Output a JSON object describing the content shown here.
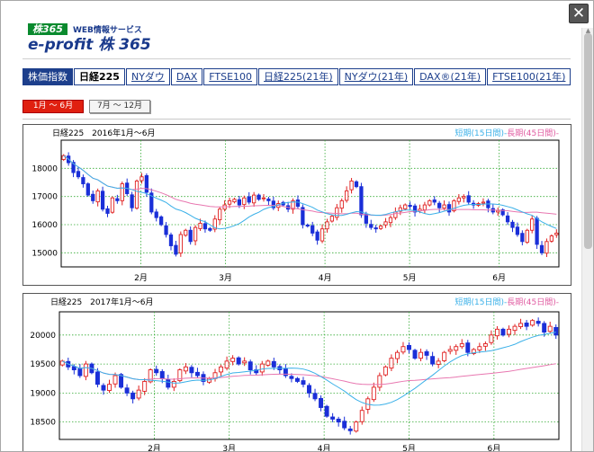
{
  "header": {
    "logo_badge": "株365",
    "logo_sub": "WEB情報サービス",
    "logo_main": "e-profit 株 365"
  },
  "icons": {
    "close": "close-icon"
  },
  "tabs": [
    {
      "label": "株価指数"
    },
    {
      "label": "日経225"
    },
    {
      "label": "NYダウ"
    },
    {
      "label": "DAX"
    },
    {
      "label": "FTSE100"
    },
    {
      "label": "日経225(21年)"
    },
    {
      "label": "NYダウ(21年)"
    },
    {
      "label": "DAX®(21年)"
    },
    {
      "label": "FTSE100(21年)"
    }
  ],
  "periods": [
    {
      "label": "1月 ～ 6月"
    },
    {
      "label": "7月 ～ 12月"
    }
  ],
  "colors": {
    "up": "#e02020",
    "down": "#1a2fd8",
    "short_ma": "#3ab0e8",
    "long_ma": "#e877b0",
    "grid": "#33aa33"
  },
  "chart_data": [
    {
      "type": "candlestick",
      "title": "日経225　2016年1月～6月",
      "legend_short": "短期(15日間)",
      "legend_sep": "-",
      "legend_long": "長期(45日間)",
      "legend_end": "-",
      "ylim": [
        14500,
        19000
      ],
      "yticks": [
        15000,
        16000,
        17000,
        18000
      ],
      "x_categories": [
        "2月",
        "3月",
        "4月",
        "5月",
        "6月"
      ],
      "close": [
        18450,
        18200,
        17850,
        17700,
        17450,
        17050,
        16850,
        17200,
        16550,
        16400,
        16950,
        16850,
        17450,
        17100,
        16600,
        17550,
        17700,
        17150,
        16450,
        16250,
        16000,
        15650,
        15250,
        14950,
        15650,
        15800,
        15400,
        15900,
        16050,
        15850,
        15800,
        16200,
        16550,
        16700,
        16850,
        16900,
        16700,
        16950,
        16800,
        17050,
        16900,
        16950,
        16850,
        16600,
        16750,
        16700,
        16550,
        16850,
        16650,
        16000,
        15950,
        15700,
        15450,
        15850,
        16100,
        16300,
        16600,
        16850,
        17200,
        17550,
        17350,
        16350,
        16050,
        15900,
        15850,
        15950,
        16100,
        16250,
        16450,
        16600,
        16700,
        16650,
        16450,
        16550,
        16700,
        16850,
        16800,
        16600,
        16700,
        16450,
        16850,
        16950,
        17000,
        16800,
        16700,
        16750,
        16800,
        16600,
        16450,
        16500,
        16350,
        16100,
        15900,
        15650,
        15400,
        15800,
        16200,
        15300,
        15000,
        15400,
        15600,
        15700
      ]
    },
    {
      "type": "candlestick",
      "title": "日経225　2017年1月～6月",
      "legend_short": "短期(15日間)",
      "legend_sep": "-",
      "legend_long": "長期(45日間)",
      "legend_end": "-",
      "ylim": [
        18200,
        20400
      ],
      "yticks": [
        18500,
        19000,
        19500,
        20000
      ],
      "x_categories": [
        "2月",
        "3月",
        "4月",
        "5月",
        "6月"
      ],
      "close": [
        19550,
        19450,
        19400,
        19300,
        19500,
        19350,
        19150,
        19050,
        19150,
        19300,
        19100,
        19000,
        18900,
        19050,
        19200,
        19400,
        19350,
        19250,
        19100,
        19200,
        19400,
        19450,
        19350,
        19300,
        19200,
        19250,
        19350,
        19450,
        19550,
        19600,
        19500,
        19550,
        19400,
        19350,
        19500,
        19550,
        19450,
        19400,
        19300,
        19250,
        19200,
        19150,
        19000,
        18900,
        18750,
        18600,
        18550,
        18500,
        18400,
        18350,
        18500,
        18700,
        18900,
        19100,
        19300,
        19450,
        19600,
        19700,
        19800,
        19750,
        19600,
        19700,
        19650,
        19500,
        19550,
        19700,
        19750,
        19800,
        19850,
        19700,
        19750,
        19800,
        19850,
        20000,
        20100,
        20000,
        20100,
        20150,
        20200,
        20150,
        20250,
        20200,
        20050,
        20150,
        20000
      ]
    }
  ]
}
